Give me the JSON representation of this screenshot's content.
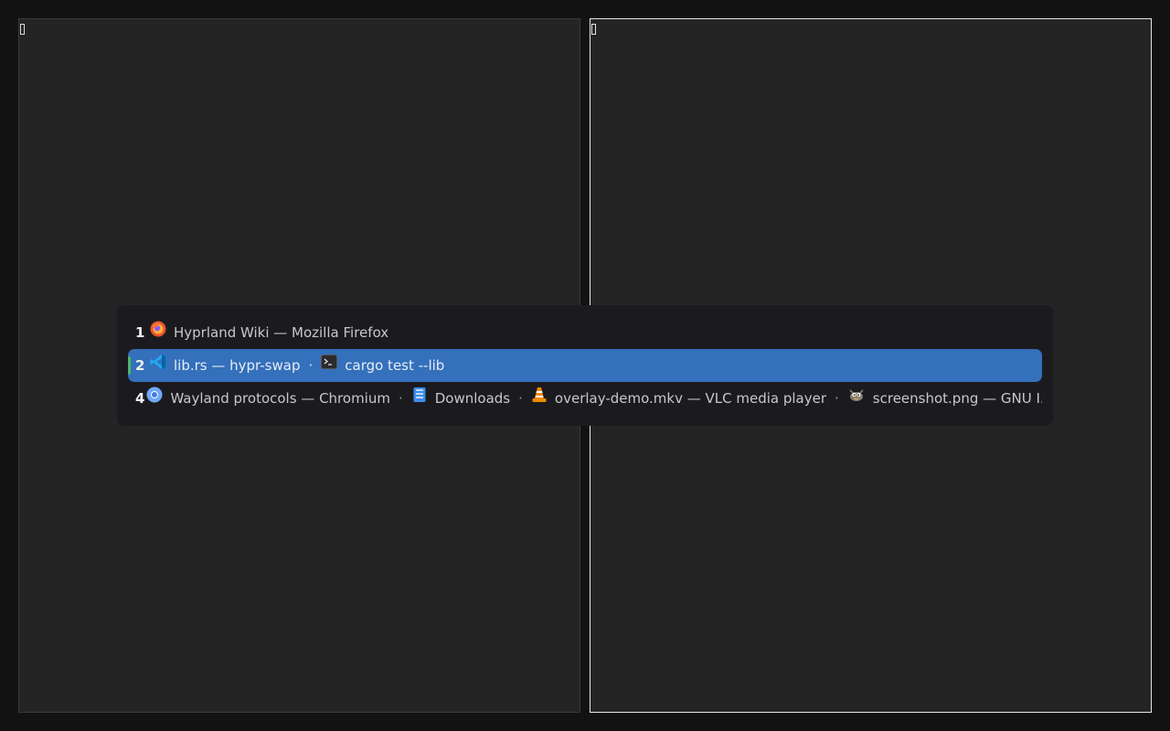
{
  "rows": [
    {
      "workspace": "1",
      "selected": false,
      "windows": [
        {
          "icon": "firefox-icon",
          "title": "Hyprland Wiki — Mozilla Firefox"
        }
      ]
    },
    {
      "workspace": "2",
      "selected": true,
      "windows": [
        {
          "icon": "vscode-icon",
          "title": "lib.rs — hypr-swap"
        },
        {
          "icon": "terminal-icon",
          "title": "cargo test --lib"
        }
      ]
    },
    {
      "workspace": "4",
      "selected": false,
      "windows": [
        {
          "icon": "chromium-icon",
          "title": "Wayland protocols — Chromium"
        },
        {
          "icon": "file-manager-icon",
          "title": "Downloads"
        },
        {
          "icon": "vlc-icon",
          "title": "overlay-demo.mkv — VLC media player"
        },
        {
          "icon": "gimp-icon",
          "title": "screenshot.png — GNU I..."
        }
      ]
    }
  ],
  "separator": "·",
  "colors": {
    "background": "#121212",
    "tile": "#242424",
    "focused_border": "#e8e8e8",
    "switcher_bg": "#1b1b1f",
    "selected_row": "#3470bb",
    "selected_marker": "#4fb46a"
  }
}
